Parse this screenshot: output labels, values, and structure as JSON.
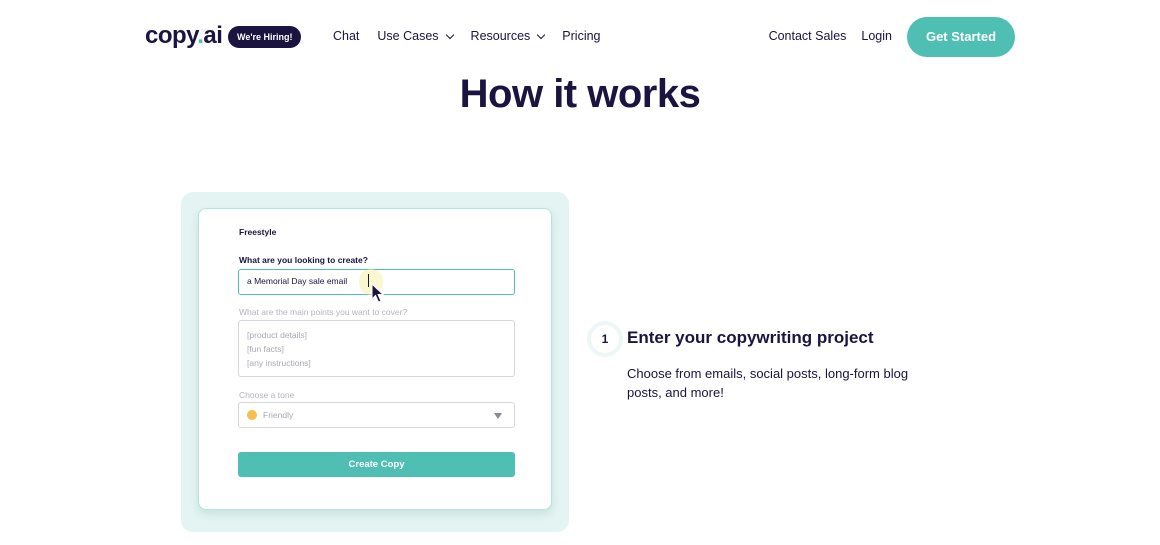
{
  "header": {
    "logo_main": "copy",
    "logo_dot": ".",
    "logo_suffix": "ai",
    "hiring_badge": "We're Hiring!",
    "nav": [
      {
        "label": "Chat",
        "dropdown": false
      },
      {
        "label": "Use Cases",
        "dropdown": true
      },
      {
        "label": "Resources",
        "dropdown": true
      },
      {
        "label": "Pricing",
        "dropdown": false
      }
    ],
    "contact_sales": "Contact Sales",
    "login": "Login",
    "get_started": "Get Started"
  },
  "section": {
    "heading": "How it works"
  },
  "demo": {
    "title": "Freestyle",
    "q1_label": "What are you looking to create?",
    "q1_value": "a Memorial Day sale email",
    "q2_label": "What are the main points you want to cover?",
    "q2_placeholder_lines": [
      "[product details]",
      "[fun facts]",
      "[any instructions]"
    ],
    "tone_label": "Choose a tone",
    "tone_value": "Friendly",
    "button": "Create Copy"
  },
  "step": {
    "number": "1",
    "title": "Enter your copywriting project",
    "description": "Choose from emails, social posts, long-form blog posts, and more!"
  },
  "colors": {
    "brand_dark": "#1b1340",
    "accent_teal": "#4fbfb4",
    "card_bg": "#e3f4f2"
  }
}
